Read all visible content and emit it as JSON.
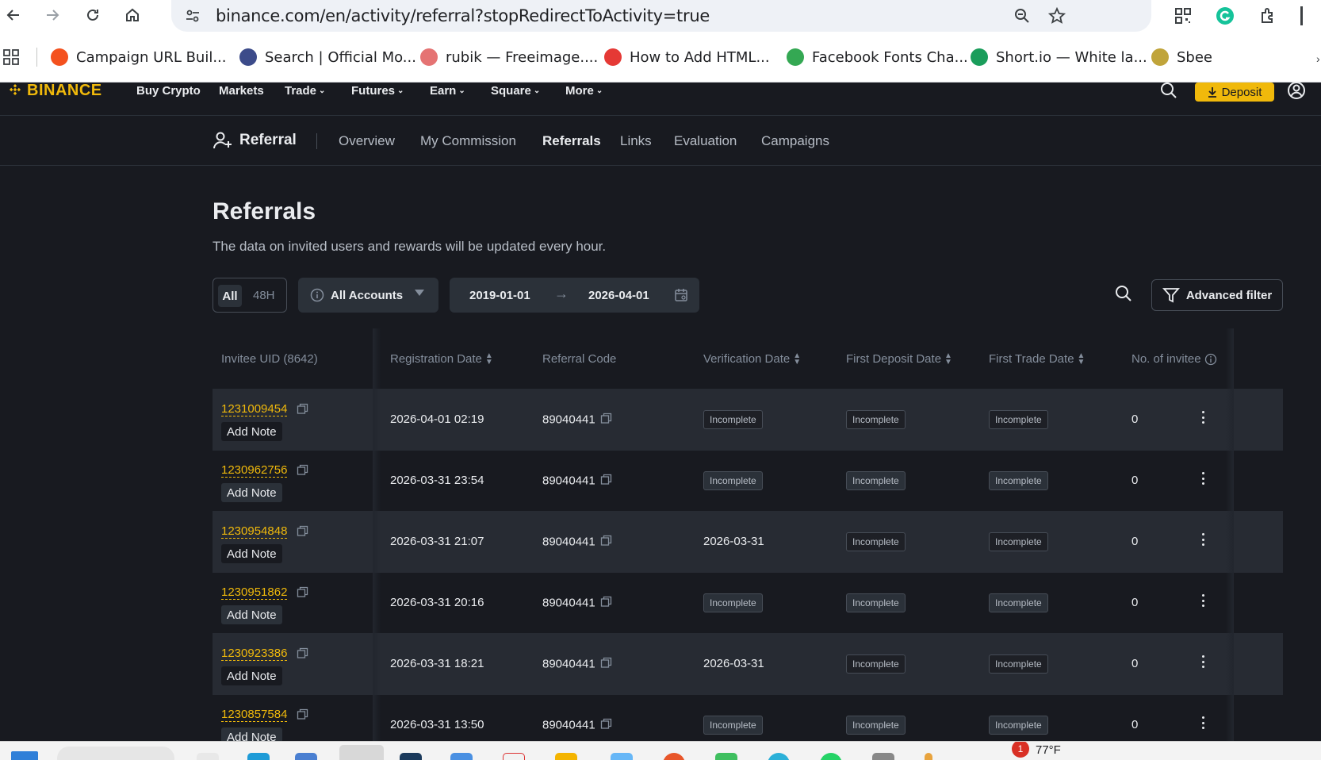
{
  "browser": {
    "url": "binance.com/en/activity/referral?stopRedirectToActivity=true",
    "bookmarks": [
      {
        "label": "Campaign URL Buil...",
        "icon": "campaign-url-builder-icon",
        "color": "#f4511e"
      },
      {
        "label": "Search | Official Mo...",
        "icon": "polygon-icon",
        "color": "#3c4b8a"
      },
      {
        "label": "rubik — Freeimage....",
        "icon": "freeimage-icon",
        "color": "#e57373"
      },
      {
        "label": "How to Add HTML...",
        "icon": "html-guide-icon",
        "color": "#e53935"
      },
      {
        "label": "Facebook Fonts Cha...",
        "icon": "play-store-icon",
        "color": "#34a853"
      },
      {
        "label": "Short.io — White la...",
        "icon": "shortio-icon",
        "color": "#1a9d5b"
      },
      {
        "label": "Sbee",
        "icon": "sbee-icon",
        "color": "#c0a43a"
      }
    ]
  },
  "header": {
    "logo": "BINANCE",
    "nav": [
      {
        "label": "Buy Crypto",
        "dropdown": false
      },
      {
        "label": "Markets",
        "dropdown": false
      },
      {
        "label": "Trade",
        "dropdown": true
      },
      {
        "label": "Futures",
        "dropdown": true
      },
      {
        "label": "Earn",
        "dropdown": true
      },
      {
        "label": "Square",
        "dropdown": true
      },
      {
        "label": "More",
        "dropdown": true
      }
    ],
    "deposit_label": "Deposit"
  },
  "subnav": {
    "title": "Referral",
    "items": [
      "Overview",
      "My Commission",
      "Referrals",
      "Links",
      "Evaluation",
      "Campaigns"
    ],
    "active": "Referrals"
  },
  "page": {
    "title": "Referrals",
    "description": "The data on invited users and rewards will be updated every hour."
  },
  "filters": {
    "period_all": "All",
    "period_48h": "48H",
    "account": "All Accounts",
    "date_from": "2019-01-01",
    "date_to": "2026-04-01",
    "advanced_filter": "Advanced filter"
  },
  "table": {
    "columns": [
      "Invitee UID (8642)",
      "Registration Date",
      "Referral Code",
      "Verification Date",
      "First Deposit Date",
      "First Trade Date",
      "No. of invitee"
    ],
    "add_note_label": "Add Note",
    "rows": [
      {
        "uid": "1231009454",
        "registration": "2026-04-01 02:19",
        "code": "89040441",
        "verification": "Incomplete",
        "deposit": "Incomplete",
        "trade": "Incomplete",
        "invitees": "0"
      },
      {
        "uid": "1230962756",
        "registration": "2026-03-31 23:54",
        "code": "89040441",
        "verification": "Incomplete",
        "deposit": "Incomplete",
        "trade": "Incomplete",
        "invitees": "0"
      },
      {
        "uid": "1230954848",
        "registration": "2026-03-31 21:07",
        "code": "89040441",
        "verification": "2026-03-31",
        "deposit": "Incomplete",
        "trade": "Incomplete",
        "invitees": "0"
      },
      {
        "uid": "1230951862",
        "registration": "2026-03-31 20:16",
        "code": "89040441",
        "verification": "Incomplete",
        "deposit": "Incomplete",
        "trade": "Incomplete",
        "invitees": "0"
      },
      {
        "uid": "1230923386",
        "registration": "2026-03-31 18:21",
        "code": "89040441",
        "verification": "2026-03-31",
        "deposit": "Incomplete",
        "trade": "Incomplete",
        "invitees": "0"
      },
      {
        "uid": "1230857584",
        "registration": "2026-03-31 13:50",
        "code": "89040441",
        "verification": "Incomplete",
        "deposit": "Incomplete",
        "trade": "Incomplete",
        "invitees": "0"
      }
    ]
  },
  "taskbar": {
    "weather": "77°F",
    "notification_count": "1"
  },
  "colors": {
    "accent": "#f0b90b",
    "background": "#181a20",
    "row_alt": "#272b33"
  }
}
